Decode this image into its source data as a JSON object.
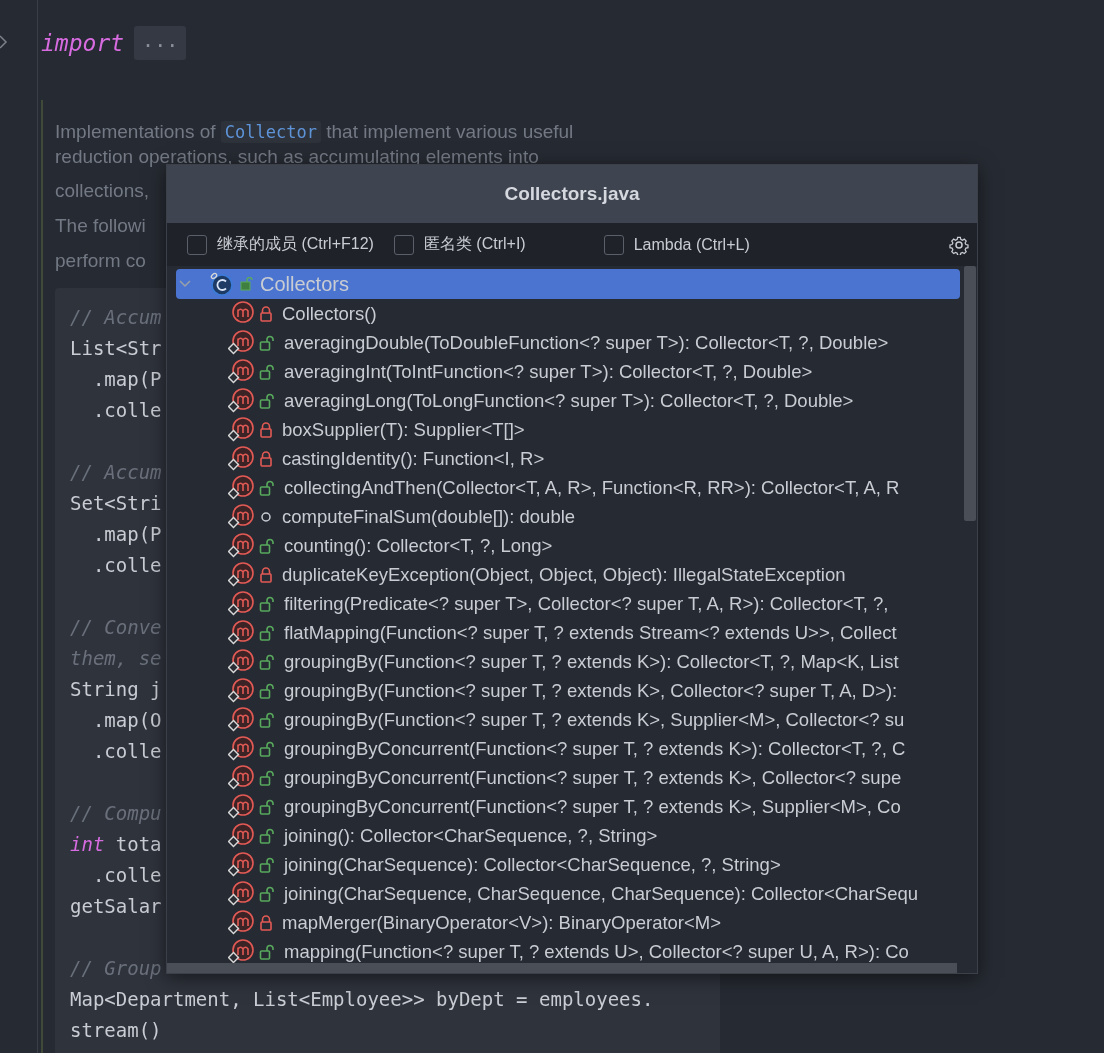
{
  "editor": {
    "import_line": {
      "keyword": "import",
      "folded": "..."
    },
    "doc": {
      "paragraphs": [
        {
          "before": "Implementations of",
          "code": "Collector",
          "after": "that implement various useful"
        },
        {
          "text": "reduction operations, such as accumulating elements into"
        },
        {
          "text": "collections,"
        },
        {
          "text": "The followi"
        },
        {
          "text": "perform co"
        }
      ]
    },
    "code_lines": [
      {
        "kind": "comment",
        "text": "// Accum"
      },
      {
        "kind": "code",
        "text": "List<Str"
      },
      {
        "kind": "code",
        "text": "  .map(P"
      },
      {
        "kind": "code",
        "text": "  .colle"
      },
      {
        "kind": "blank"
      },
      {
        "kind": "comment",
        "text": "// Accum"
      },
      {
        "kind": "code",
        "text": "Set<Stri"
      },
      {
        "kind": "code",
        "text": "  .map(P"
      },
      {
        "kind": "code",
        "text": "  .colle"
      },
      {
        "kind": "blank"
      },
      {
        "kind": "comment",
        "text": "// Conve"
      },
      {
        "kind": "comment",
        "text": "them, se"
      },
      {
        "kind": "code",
        "text": "String j"
      },
      {
        "kind": "code",
        "text": "  .map(O"
      },
      {
        "kind": "code",
        "text": "  .colle"
      },
      {
        "kind": "blank"
      },
      {
        "kind": "comment",
        "text": "// Compu"
      },
      {
        "kind": "keyword",
        "keyword": "int",
        "text": " tota"
      },
      {
        "kind": "code",
        "text": "  .colle"
      },
      {
        "kind": "code",
        "text": "getSalar"
      },
      {
        "kind": "blank"
      },
      {
        "kind": "comment",
        "text": "// Group"
      },
      {
        "kind": "code",
        "text": "Map<Department, List<Employee>> byDept = employees."
      },
      {
        "kind": "code",
        "text": "stream()"
      }
    ]
  },
  "structure_popup": {
    "title": "Collectors.java",
    "filters": [
      {
        "label": "继承的成员 (Ctrl+F12)",
        "checked": false
      },
      {
        "label": "匿名类 (Ctrl+I)",
        "checked": false
      },
      {
        "label": "Lambda (Ctrl+L)",
        "checked": false
      }
    ],
    "root": {
      "label": "Collectors",
      "expanded": true,
      "selected": true,
      "kind": "public",
      "children": [
        {
          "label": "Collectors()",
          "kind": "private",
          "static": false
        },
        {
          "label": "averagingDouble(ToDoubleFunction<? super T>): Collector<T, ?, Double>",
          "kind": "public",
          "static": true
        },
        {
          "label": "averagingInt(ToIntFunction<? super T>): Collector<T, ?, Double>",
          "kind": "public",
          "static": true
        },
        {
          "label": "averagingLong(ToLongFunction<? super T>): Collector<T, ?, Double>",
          "kind": "public",
          "static": true
        },
        {
          "label": "boxSupplier(T): Supplier<T[]>",
          "kind": "private",
          "static": true
        },
        {
          "label": "castingIdentity(): Function<I, R>",
          "kind": "private",
          "static": true
        },
        {
          "label": "collectingAndThen(Collector<T, A, R>, Function<R, RR>): Collector<T, A, R",
          "kind": "public",
          "static": true
        },
        {
          "label": "computeFinalSum(double[]): double",
          "kind": "package",
          "static": true
        },
        {
          "label": "counting(): Collector<T, ?, Long>",
          "kind": "public",
          "static": true
        },
        {
          "label": "duplicateKeyException(Object, Object, Object): IllegalStateException",
          "kind": "private",
          "static": true
        },
        {
          "label": "filtering(Predicate<? super T>, Collector<? super T, A, R>): Collector<T, ?,",
          "kind": "public",
          "static": true
        },
        {
          "label": "flatMapping(Function<? super T, ? extends Stream<? extends U>>, Collect",
          "kind": "public",
          "static": true
        },
        {
          "label": "groupingBy(Function<? super T, ? extends K>): Collector<T, ?, Map<K, List",
          "kind": "public",
          "static": true
        },
        {
          "label": "groupingBy(Function<? super T, ? extends K>, Collector<? super T, A, D>):",
          "kind": "public",
          "static": true
        },
        {
          "label": "groupingBy(Function<? super T, ? extends K>, Supplier<M>, Collector<? su",
          "kind": "public",
          "static": true
        },
        {
          "label": "groupingByConcurrent(Function<? super T, ? extends K>): Collector<T, ?, C",
          "kind": "public",
          "static": true
        },
        {
          "label": "groupingByConcurrent(Function<? super T, ? extends K>, Collector<? supe",
          "kind": "public",
          "static": true
        },
        {
          "label": "groupingByConcurrent(Function<? super T, ? extends K>, Supplier<M>, Co",
          "kind": "public",
          "static": true
        },
        {
          "label": "joining(): Collector<CharSequence, ?, String>",
          "kind": "public",
          "static": true
        },
        {
          "label": "joining(CharSequence): Collector<CharSequence, ?, String>",
          "kind": "public",
          "static": true
        },
        {
          "label": "joining(CharSequence, CharSequence, CharSequence): Collector<CharSequ",
          "kind": "public",
          "static": true
        },
        {
          "label": "mapMerger(BinaryOperator<V>): BinaryOperator<M>",
          "kind": "private",
          "static": true
        },
        {
          "label": "mapping(Function<? super T, ? extends U>, Collector<? super U, A, R>): Co",
          "kind": "public",
          "static": true
        }
      ]
    }
  }
}
